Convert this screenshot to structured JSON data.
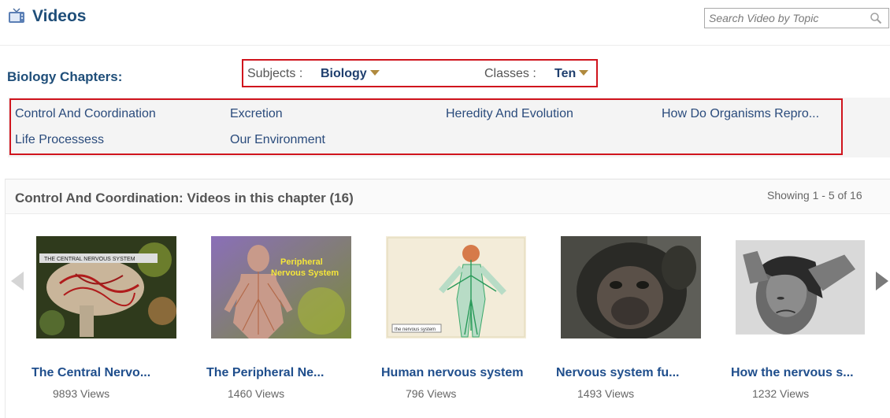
{
  "header": {
    "title": "Videos",
    "search_placeholder": "Search Video by Topic"
  },
  "chapters_label": "Biology Chapters:",
  "filters": {
    "subjects_label": "Subjects :",
    "subjects_value": "Biology",
    "classes_label": "Classes :",
    "classes_value": "Ten"
  },
  "chapters": [
    "Control And Coordination",
    "Excretion",
    "Heredity And Evolution",
    "How Do Organisms Repro...",
    "Life Processess",
    "Our Environment"
  ],
  "videos_section": {
    "title": "Control And Coordination: Videos in this chapter (16)",
    "showing": "Showing 1 - 5 of 16"
  },
  "videos": [
    {
      "title": "The Central Nervo...",
      "views": "9893  Views",
      "thumb_text": "THE CENTRAL NERVOUS SYSTEM",
      "icon": "brain-thumbnail"
    },
    {
      "title": "The Peripheral Ne...",
      "views": "1460  Views",
      "thumb_text_1": "Peripheral",
      "thumb_text_2": "Nervous System",
      "icon": "body-nerves-thumbnail"
    },
    {
      "title": "Human nervous system",
      "views": "796  Views",
      "thumb_text": "the nervous system",
      "icon": "nervous-system-diagram-thumbnail"
    },
    {
      "title": "Nervous system fu...",
      "views": "1493  Views",
      "icon": "gorilla-thumbnail"
    },
    {
      "title": "How the nervous s...",
      "views": "1232  Views",
      "icon": "headache-person-thumbnail"
    }
  ],
  "colors": {
    "accent": "#1f4e79",
    "highlight_border": "#d0141d",
    "link": "#2a4b7c"
  }
}
